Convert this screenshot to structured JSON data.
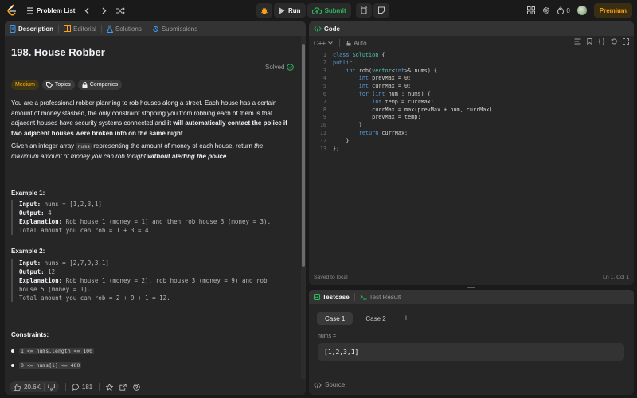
{
  "topbar": {
    "problem_list": "Problem List",
    "run": "Run",
    "submit": "Submit",
    "streak": "0",
    "premium": "Premium"
  },
  "left": {
    "tabs": [
      "Description",
      "Editorial",
      "Solutions",
      "Submissions"
    ],
    "title": "198. House Robber",
    "solved": "Solved",
    "tags": [
      "Medium",
      "Topics",
      "Companies"
    ],
    "para1": {
      "plain": "You are a professional robber planning to rob houses along a street. Each house has a certain amount of money stashed, the only constraint stopping you from robbing each of them is that adjacent houses have security systems connected and ",
      "bold": "it will automatically contact the police if two adjacent houses were broken into on the same night",
      "end": "."
    },
    "para2": {
      "a": "Given an integer array ",
      "code": "nums",
      "b": " representing the amount of money of each house, return ",
      "italic": "the maximum amount of money you can rob tonight ",
      "bolditalic": "without alerting the police",
      "end": "."
    },
    "examples": [
      {
        "heading": "Example 1:",
        "input_label": "Input:",
        "input": " nums = [1,2,3,1]",
        "output_label": "Output:",
        "output": " 4",
        "expl_label": "Explanation:",
        "expl": " Rob house 1 (money = 1) and then rob house 3 (money = 3).",
        "total": "Total amount you can rob = 1 + 3 = 4."
      },
      {
        "heading": "Example 2:",
        "input_label": "Input:",
        "input": " nums = [2,7,9,3,1]",
        "output_label": "Output:",
        "output": " 12",
        "expl_label": "Explanation:",
        "expl": " Rob house 1 (money = 2), rob house 3 (money = 9) and rob",
        "expl2": "house 5 (money = 1).",
        "total": "Total amount you can rob = 2 + 9 + 1 = 12."
      }
    ],
    "constraints_heading": "Constraints:",
    "constraints": [
      "1 <= nums.length <= 100",
      "0 <= nums[i] <= 400"
    ],
    "likes": "20.6K",
    "comments": "181"
  },
  "code": {
    "tab": "Code",
    "language": "C++",
    "mode": "Auto",
    "lines": [
      "1",
      "2",
      "3",
      "4",
      "5",
      "6",
      "7",
      "8",
      "9",
      "10",
      "11",
      "12",
      "13"
    ],
    "status_left": "Saved to local",
    "status_right": "Ln 1, Col 1"
  },
  "test": {
    "tabs": [
      "Testcase",
      "Test Result"
    ],
    "cases": [
      "Case 1",
      "Case 2"
    ],
    "plus": "+",
    "param": "nums =",
    "value": "[1,2,3,1]",
    "source": "Source"
  },
  "colors": {
    "accent": "#ffa116",
    "green": "#2cbb5d",
    "medium": "#ffb800",
    "panel": "#262626"
  }
}
